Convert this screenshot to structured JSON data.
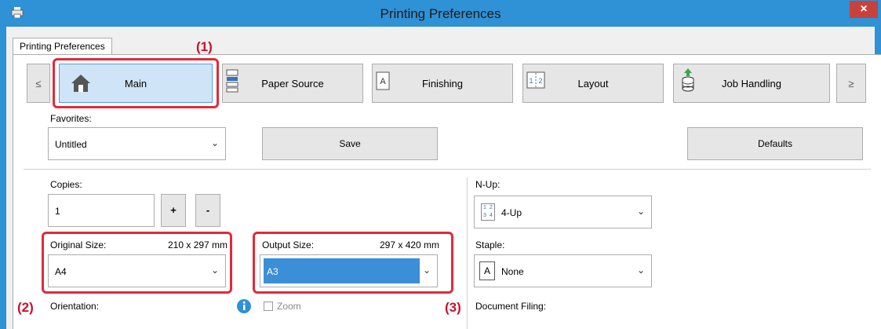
{
  "window": {
    "title": "Printing Preferences",
    "close_label": "×"
  },
  "tab": {
    "label": "Printing Preferences"
  },
  "nav": {
    "prev_label": "≤",
    "next_label": "≥",
    "items": [
      {
        "label": "Main",
        "icon": "home-icon",
        "active": true
      },
      {
        "label": "Paper Source",
        "icon": "paper-source-icon",
        "active": false
      },
      {
        "label": "Finishing",
        "icon": "finishing-icon",
        "active": false
      },
      {
        "label": "Layout",
        "icon": "layout-icon",
        "active": false
      },
      {
        "label": "Job Handling",
        "icon": "job-handling-icon",
        "active": false
      }
    ]
  },
  "favorites": {
    "label": "Favorites:",
    "value": "Untitled",
    "save_label": "Save",
    "defaults_label": "Defaults"
  },
  "copies": {
    "label": "Copies:",
    "value": "1",
    "plus": "+",
    "minus": "-"
  },
  "original_size": {
    "label": "Original Size:",
    "dims": "210 x 297 mm",
    "value": "A4"
  },
  "output_size": {
    "label": "Output Size:",
    "dims": "297 x 420 mm",
    "value": "A3"
  },
  "nup": {
    "label": "N-Up:",
    "value": "4-Up",
    "icon_digits": [
      "1",
      "2",
      "3",
      "4"
    ]
  },
  "staple": {
    "label": "Staple:",
    "value": "None",
    "icon_letter": "A"
  },
  "orientation": {
    "label": "Orientation:"
  },
  "zoom": {
    "label": "Zoom"
  },
  "document_filing": {
    "label": "Document Filing:"
  },
  "callouts": {
    "c1": "(1)",
    "c2": "(2)",
    "c3": "(3)"
  },
  "colors": {
    "titlebar": "#2f91d6",
    "highlight": "#e02b3b",
    "selection": "#3a8fd7",
    "callout_text": "#c8102e"
  }
}
